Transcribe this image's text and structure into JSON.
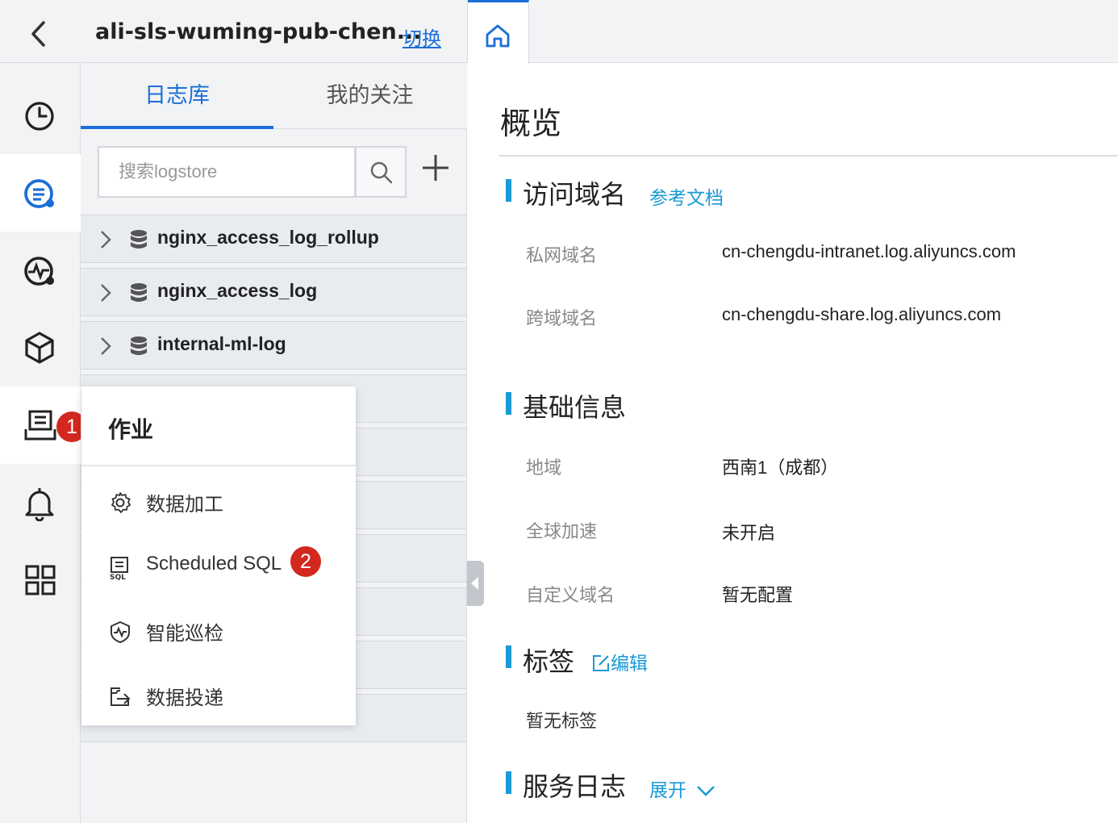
{
  "header": {
    "project_name": "ali-sls-wuming-pub-chen...",
    "switch_label": "切换"
  },
  "log_panel": {
    "tabs": [
      {
        "label": "日志库",
        "active": true
      },
      {
        "label": "我的关注",
        "active": false
      }
    ],
    "search": {
      "placeholder": "搜索logstore"
    },
    "logstores": [
      {
        "name": "nginx_access_log_rollup"
      },
      {
        "name": "nginx_access_log"
      },
      {
        "name": "internal-ml-log"
      }
    ]
  },
  "rail": {
    "badge_1": "1",
    "icons": [
      "clock-icon",
      "log-search-icon",
      "monitor-icon",
      "box-icon",
      "job-icon",
      "bell-icon",
      "grid-icon"
    ]
  },
  "popup": {
    "title": "作业",
    "items": [
      {
        "label": "数据加工",
        "icon": "gear-icon"
      },
      {
        "label": "Scheduled SQL",
        "icon": "sql-icon",
        "badge": "2"
      },
      {
        "label": "智能巡检",
        "icon": "shield-pulse-icon"
      },
      {
        "label": "数据投递",
        "icon": "export-icon"
      }
    ]
  },
  "overview": {
    "title": "概览",
    "access_domain": {
      "title": "访问域名",
      "doc_link": "参考文档",
      "rows": [
        {
          "key": "私网域名",
          "value": "cn-chengdu-intranet.log.aliyuncs.com"
        },
        {
          "key": "跨域域名",
          "value": "cn-chengdu-share.log.aliyuncs.com"
        }
      ]
    },
    "basic_info": {
      "title": "基础信息",
      "rows": [
        {
          "key": "地域",
          "value": "西南1（成都）"
        },
        {
          "key": "全球加速",
          "value": "未开启"
        },
        {
          "key": "自定义域名",
          "value": "暂无配置"
        }
      ]
    },
    "tags": {
      "title": "标签",
      "edit_label": "编辑",
      "empty_text": "暂无标签"
    },
    "service_log": {
      "title": "服务日志",
      "expand_label": "展开"
    }
  },
  "colors": {
    "accent": "#1a6fd8",
    "section_bar": "#1a9ad6",
    "badge": "#d3281f",
    "top_accent": "#ff6a00"
  }
}
